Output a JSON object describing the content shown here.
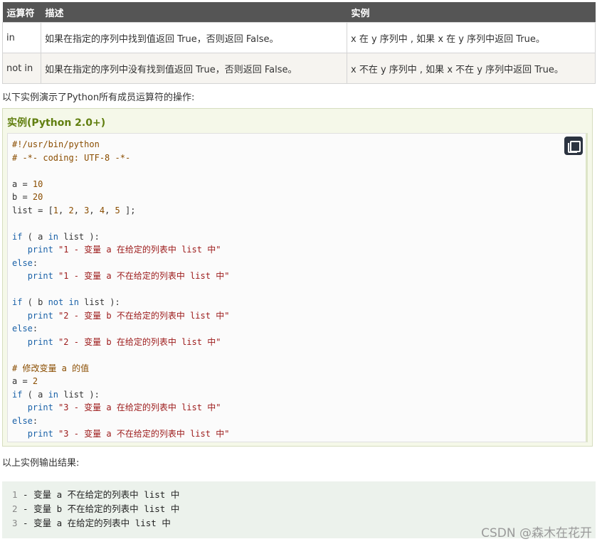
{
  "table": {
    "headers": [
      "运算符",
      "描述",
      "实例"
    ],
    "rows": [
      {
        "op": "in",
        "desc": "如果在指定的序列中找到值返回 True，否则返回 False。",
        "example": "x 在 y 序列中 , 如果 x 在 y 序列中返回 True。"
      },
      {
        "op": "not in",
        "desc": "如果在指定的序列中没有找到值返回 True，否则返回 False。",
        "example": "x 不在 y 序列中 , 如果 x 不在 y 序列中返回 True。"
      }
    ]
  },
  "intro_text": "以下实例演示了Python所有成员运算符的操作:",
  "example": {
    "title": "实例(Python 2.0+)",
    "copy_icon": "copy-icon",
    "code_lines": [
      "#!/usr/bin/python",
      "# -*- coding: UTF-8 -*-",
      "",
      "a = 10",
      "b = 20",
      "list = [1, 2, 3, 4, 5 ];",
      "",
      "if ( a in list ):",
      "   print \"1 - 变量 a 在给定的列表中 list 中\"",
      "else:",
      "   print \"1 - 变量 a 不在给定的列表中 list 中\"",
      "",
      "if ( b not in list ):",
      "   print \"2 - 变量 b 不在给定的列表中 list 中\"",
      "else:",
      "   print \"2 - 变量 b 在给定的列表中 list 中\"",
      "",
      "# 修改变量 a 的值",
      "a = 2",
      "if ( a in list ):",
      "   print \"3 - 变量 a 在给定的列表中 list 中\"",
      "else:",
      "   print \"3 - 变量 a 不在给定的列表中 list 中\""
    ]
  },
  "output_intro": "以上实例输出结果:",
  "output": {
    "lines": [
      {
        "num": "1",
        "text": " - 变量 a 不在给定的列表中 list 中"
      },
      {
        "num": "2",
        "text": " - 变量 b 不在给定的列表中 list 中"
      },
      {
        "num": "3",
        "text": " - 变量 a 在给定的列表中 list 中"
      }
    ]
  },
  "watermark": "CSDN @森木在花开",
  "colors": {
    "header_bg": "#555555",
    "example_title": "#617f10",
    "comment": "#8a4d00",
    "keyword": "#1b62a8",
    "string": "#9c1a1a",
    "number": "#8a4d00"
  }
}
